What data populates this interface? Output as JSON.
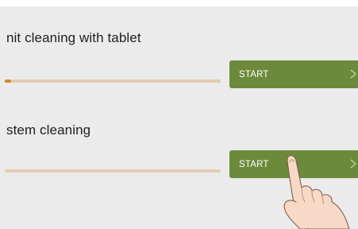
{
  "programs": [
    {
      "title": "nit cleaning with tablet",
      "progress_fraction": 0.03,
      "button_label": "START"
    },
    {
      "title": "stem cleaning",
      "progress_fraction": 0.0,
      "button_label": "START"
    }
  ],
  "icons": {
    "button_chevron": "chevron-right-icon",
    "pointer": "pointing-hand-icon"
  },
  "colors": {
    "background": "#ebebeb",
    "button": "#6b8a3b",
    "progress_track": "#e3cdb0",
    "progress_fill": "#d08a36",
    "text": "#1f1f1f"
  }
}
